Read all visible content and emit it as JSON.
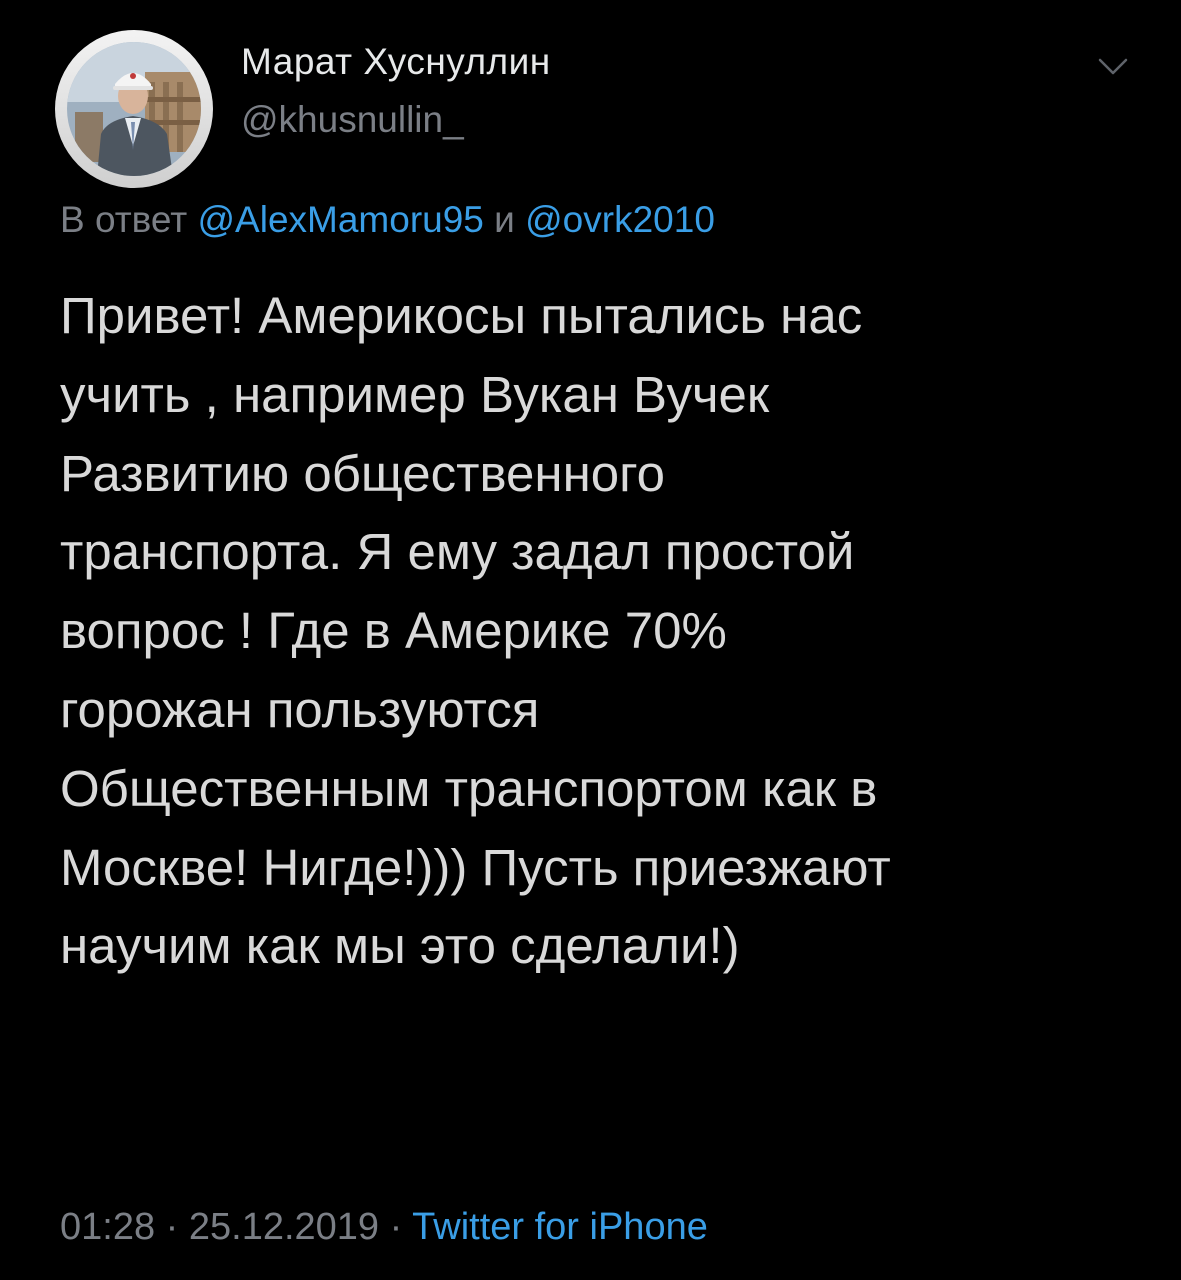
{
  "author": {
    "name": "Марат Хуснуллин",
    "handle": "@khusnullin_"
  },
  "reply": {
    "prefix": "В ответ",
    "user1": "@AlexMamoru95",
    "conjunction": "и",
    "user2": "@ovrk2010"
  },
  "tweet": {
    "lines": [
      "Привет! Америкосы пытались нас",
      "учить , например Вукан Вучек",
      "Развитию общественного",
      "транспорта. Я ему задал простой",
      "вопрос ! Где в Америке 70%",
      "горожан пользуются",
      "Общественным транспортом как в",
      "Москве! Нигде!))) Пусть приезжают",
      "научим как мы это сделали!)"
    ]
  },
  "meta": {
    "time": "01:28",
    "separator": "·",
    "date": "25.12.2019",
    "source": "Twitter for iPhone"
  },
  "icons": {
    "more": "chevron-down-icon"
  },
  "colors": {
    "background": "#000000",
    "text": "#d9d9d9",
    "secondary": "#7b7f86",
    "link": "#3a9ee6"
  }
}
